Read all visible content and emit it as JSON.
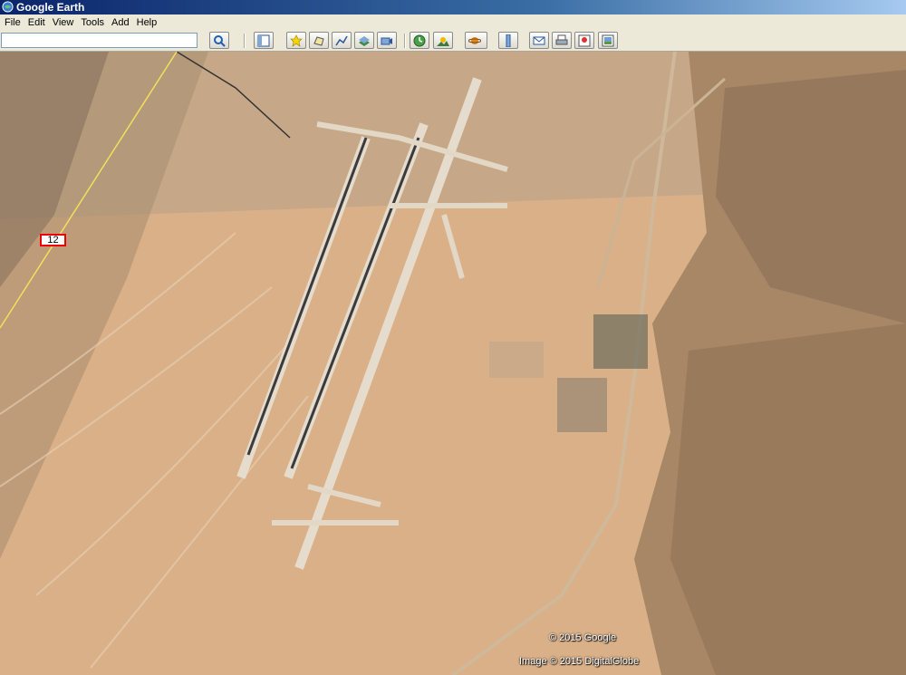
{
  "window": {
    "title": "Google Earth"
  },
  "menu": [
    "File",
    "Edit",
    "View",
    "Tools",
    "Add",
    "Help"
  ],
  "search": {
    "value": "",
    "placeholder": ""
  },
  "toolbar": {
    "buttons": [
      "search-icon",
      "sidebar-icon",
      "placemark-icon",
      "polygon-icon",
      "path-icon",
      "overlay-icon",
      "tour-icon",
      "history-icon",
      "sunlight-icon",
      "planets-icon",
      "ruler-icon",
      "email-icon",
      "print-icon",
      "maps-icon",
      "save-image-icon"
    ]
  },
  "map": {
    "road_label": "12",
    "copyright": "© 2015 Google",
    "imagery": "Image © 2015 DigitalGlobe"
  },
  "colors": {
    "titlebar": "#0a246a",
    "desert": "#d9b088",
    "shield_border": "#ee0000"
  }
}
